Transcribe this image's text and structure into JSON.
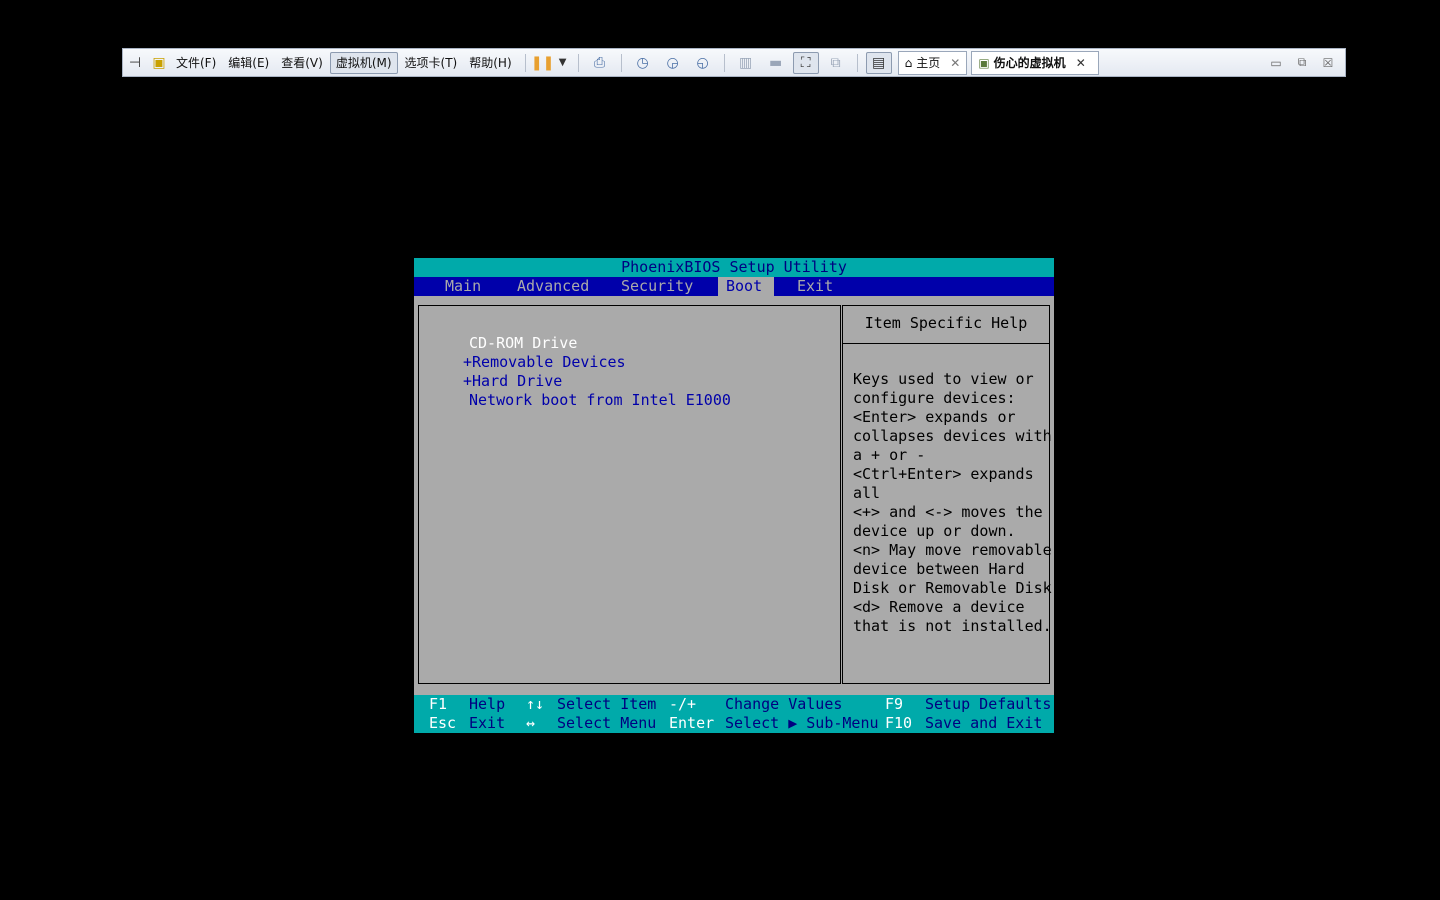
{
  "toolbar": {
    "menus": [
      "文件(F)",
      "编辑(E)",
      "查看(V)",
      "虚拟机(M)",
      "选项卡(T)",
      "帮助(H)"
    ],
    "tabs": [
      {
        "label": "主页"
      },
      {
        "label": "伤心的虚拟机"
      }
    ]
  },
  "bios": {
    "title": "PhoenixBIOS Setup Utility",
    "menus": [
      "Main",
      "Advanced",
      "Security",
      "Boot",
      "Exit"
    ],
    "active_menu": "Boot",
    "boot_items": [
      "CD-ROM Drive",
      "+Removable Devices",
      "+Hard Drive",
      "Network boot from Intel E1000"
    ],
    "help_title": "Item Specific Help",
    "help_text": "Keys used to view or\nconfigure devices:\n<Enter> expands or\ncollapses devices with\na + or -\n<Ctrl+Enter> expands\nall\n<+> and <-> moves the\ndevice up or down.\n<n> May move removable\ndevice between Hard\nDisk or Removable Disk\n<d> Remove a device\nthat is not installed.",
    "footer": {
      "row1": [
        {
          "key": "F1",
          "label": "Help"
        },
        {
          "key": "↑↓",
          "label": "Select Item"
        },
        {
          "key": "-/+",
          "label": "Change Values"
        },
        {
          "key": "F9",
          "label": "Setup Defaults"
        }
      ],
      "row2": [
        {
          "key": "Esc",
          "label": "Exit"
        },
        {
          "key": "↔",
          "label": "Select Menu"
        },
        {
          "key": "Enter",
          "label": "Select ▶ Sub-Menu"
        },
        {
          "key": "F10",
          "label": "Save and Exit"
        }
      ]
    }
  }
}
